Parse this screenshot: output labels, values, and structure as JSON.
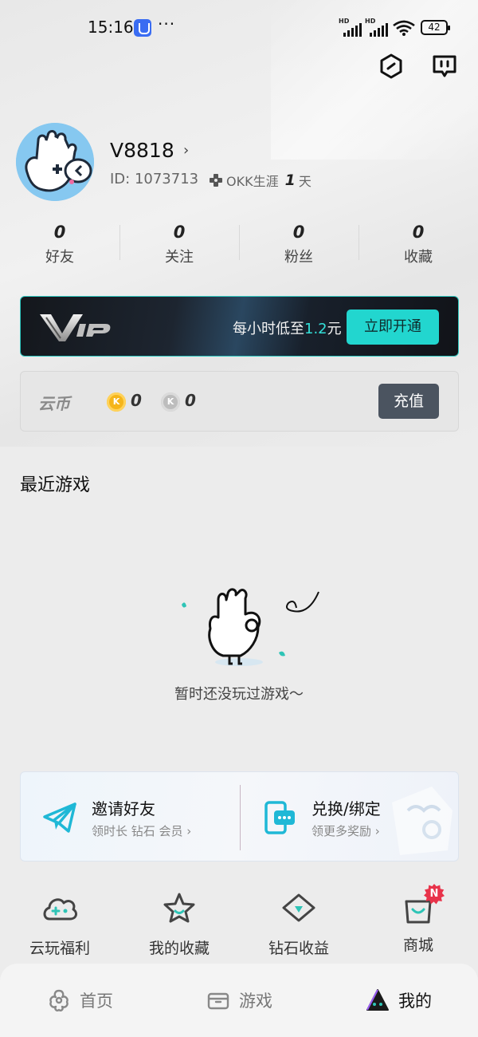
{
  "status_bar": {
    "time": "15:16",
    "dots": "···",
    "signal_1_label": "HD",
    "signal_2_label": "HD",
    "battery": "42"
  },
  "icons": {
    "settings": "hexagon-settings-icon",
    "message": "chat-icon"
  },
  "profile": {
    "username": "V8818",
    "chevron": "›",
    "id_text": "ID:  1073713",
    "career_label": "OKK生涯",
    "career_days": "1",
    "career_unit": "天"
  },
  "stats": [
    {
      "value": "0",
      "label": "好友"
    },
    {
      "value": "0",
      "label": "关注"
    },
    {
      "value": "0",
      "label": "粉丝"
    },
    {
      "value": "0",
      "label": "收藏"
    }
  ],
  "vip": {
    "text_prefix": "每小时低至",
    "price": "1.2",
    "text_suffix": "元",
    "button": "立即开通",
    "accent": "#22d6cf"
  },
  "coins": {
    "title": "云币",
    "gold_symbol": "K",
    "gold_value": "0",
    "silver_symbol": "K",
    "silver_value": "0",
    "button": "充值"
  },
  "recent_games": {
    "title": "最近游戏",
    "empty_text": "暂时还没玩过游戏～"
  },
  "promo": {
    "invite_title": "邀请好友",
    "invite_sub": "领时长 钻石 会员 ›",
    "redeem_title": "兑换/绑定",
    "redeem_sub": "领更多奖励 ›"
  },
  "quick_actions": [
    {
      "label": "云玩福利",
      "icon": "gamepad-cloud-icon"
    },
    {
      "label": "我的收藏",
      "icon": "star-icon"
    },
    {
      "label": "钻石收益",
      "icon": "diamond-icon"
    },
    {
      "label": "商城",
      "icon": "shopping-bag-icon",
      "badge": "N"
    }
  ],
  "bottom_nav": [
    {
      "label": "首页",
      "icon": "home-clover-icon",
      "active": false
    },
    {
      "label": "游戏",
      "icon": "box-icon",
      "active": false
    },
    {
      "label": "我的",
      "icon": "mine-face-icon",
      "active": true
    }
  ]
}
